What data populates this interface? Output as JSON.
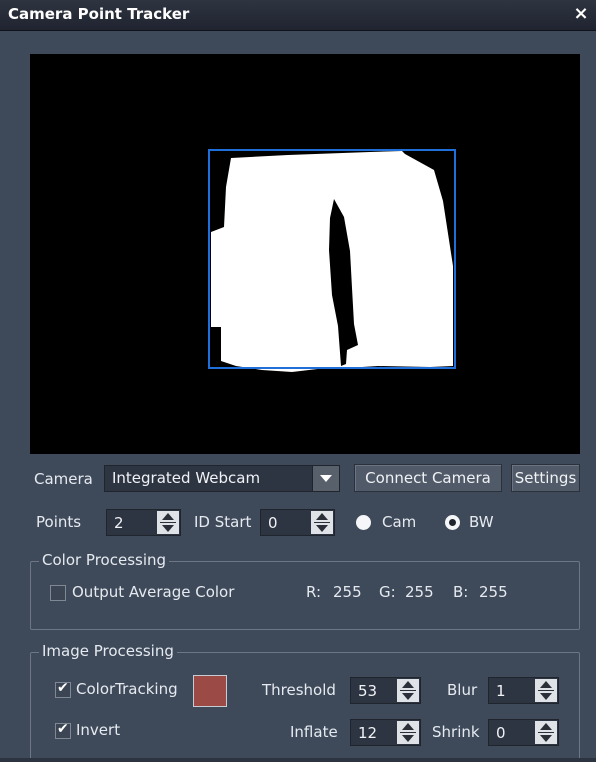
{
  "window": {
    "title": "Camera Point Tracker",
    "close_glyph": "×"
  },
  "camera": {
    "label": "Camera",
    "selected": "Integrated Webcam",
    "connect_label": "Connect Camera",
    "settings_label": "Settings"
  },
  "points": {
    "label": "Points",
    "value": "2",
    "id_start_label": "ID Start",
    "id_start_value": "0",
    "mode_options": [
      "Cam",
      "BW"
    ],
    "mode_selected": "BW"
  },
  "color_processing": {
    "legend": "Color Processing",
    "output_avg_label": "Output Average Color",
    "output_avg_checked": false,
    "r_label": "R:",
    "r_value": "255",
    "g_label": "G:",
    "g_value": "255",
    "b_label": "B:",
    "b_value": "255"
  },
  "image_processing": {
    "legend": "Image Processing",
    "color_tracking_label": "ColorTracking",
    "color_tracking_checked": true,
    "tracking_color": "#9c4a45",
    "invert_label": "Invert",
    "invert_checked": true,
    "threshold_label": "Threshold",
    "threshold_value": "53",
    "blur_label": "Blur",
    "blur_value": "1",
    "inflate_label": "Inflate",
    "inflate_value": "12",
    "shrink_label": "Shrink",
    "shrink_value": "0"
  },
  "colors": {
    "panel_bg": "#3e4a5a",
    "preview_bg": "#000000",
    "tracking_box": "#1e6fd8",
    "blob": "#ffffff"
  }
}
